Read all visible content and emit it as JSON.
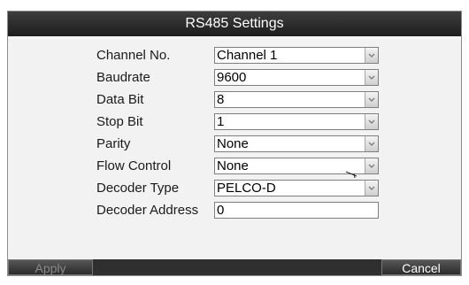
{
  "window": {
    "title": "RS485 Settings"
  },
  "fields": [
    {
      "label": "Channel No.",
      "value": "Channel 1",
      "type": "select"
    },
    {
      "label": "Baudrate",
      "value": "9600",
      "type": "select"
    },
    {
      "label": "Data Bit",
      "value": "8",
      "type": "select"
    },
    {
      "label": "Stop Bit",
      "value": "1",
      "type": "select"
    },
    {
      "label": "Parity",
      "value": "None",
      "type": "select"
    },
    {
      "label": "Flow Control",
      "value": "None",
      "type": "select"
    },
    {
      "label": "Decoder Type",
      "value": "PELCO-D",
      "type": "select"
    },
    {
      "label": "Decoder Address",
      "value": "0",
      "type": "text"
    }
  ],
  "buttons": {
    "apply": "Apply",
    "cancel": "Cancel"
  },
  "colors": {
    "titlebar": "#1c1c1c",
    "panel": "#f2f2f2",
    "bottombar": "#2f2f2f"
  },
  "icons": {
    "dropdown": "chevron-down-icon",
    "cursor": "mouse-cursor-icon"
  }
}
